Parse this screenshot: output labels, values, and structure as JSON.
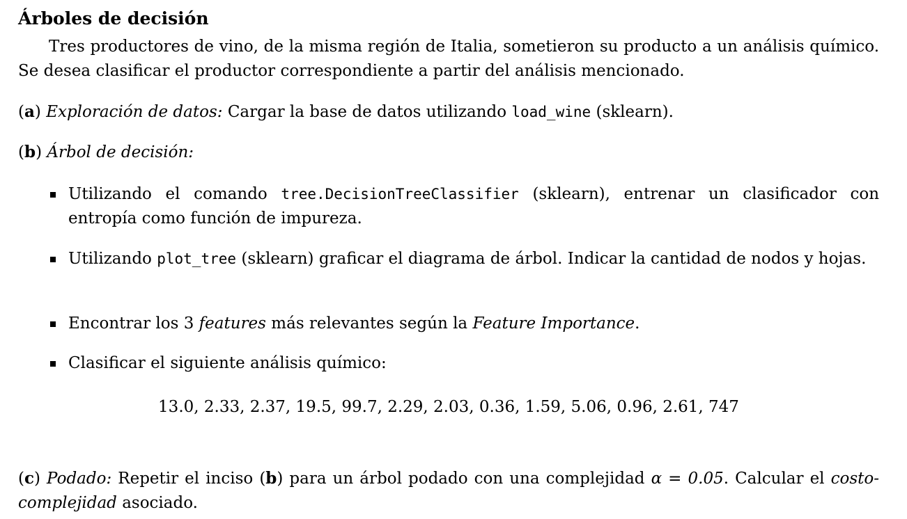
{
  "title": "Árboles de decisión",
  "intro": "Tres productores de vino, de la misma región de Italia, sometieron su producto a un análisis químico. Se desea clasificar el productor correspondiente a partir del análisis mencionado.",
  "a": {
    "mark": "a",
    "heading": "Exploración de datos:",
    "text_before": "Cargar la base de datos utilizando",
    "code": "load_wine",
    "text_after": "(sklearn)."
  },
  "b": {
    "mark": "b",
    "heading": "Árbol de decisión:",
    "bullets": [
      {
        "before": "Utilizando el comando",
        "code": "tree.DecisionTreeClassifier",
        "after": "(sklearn), entrenar un clasificador con entropía como función de impureza."
      },
      {
        "before": "Utilizando",
        "code": "plot_tree",
        "after": "(sklearn) graficar el diagrama de árbol. Indicar la cantidad de nodos y hojas."
      },
      {
        "before": "Encontrar los 3",
        "italic": "features",
        "middle": "más relevantes según la",
        "italic2": "Feature Importance",
        "after": "."
      },
      {
        "text": "Clasificar el siguiente análisis químico:"
      }
    ],
    "values": "13.0, 2.33, 2.37, 19.5, 99.7, 2.29, 2.03, 0.36, 1.59, 5.06, 0.96, 2.61, 747"
  },
  "c": {
    "mark": "c",
    "heading": "Podado:",
    "text1": "Repetir el inciso (",
    "ref": "b",
    "text2": ") para un árbol podado con una complejidad",
    "alpha": "α = 0.05",
    "text3": ". Calcular el",
    "italic": "costo-complejidad",
    "text4": "asociado."
  }
}
